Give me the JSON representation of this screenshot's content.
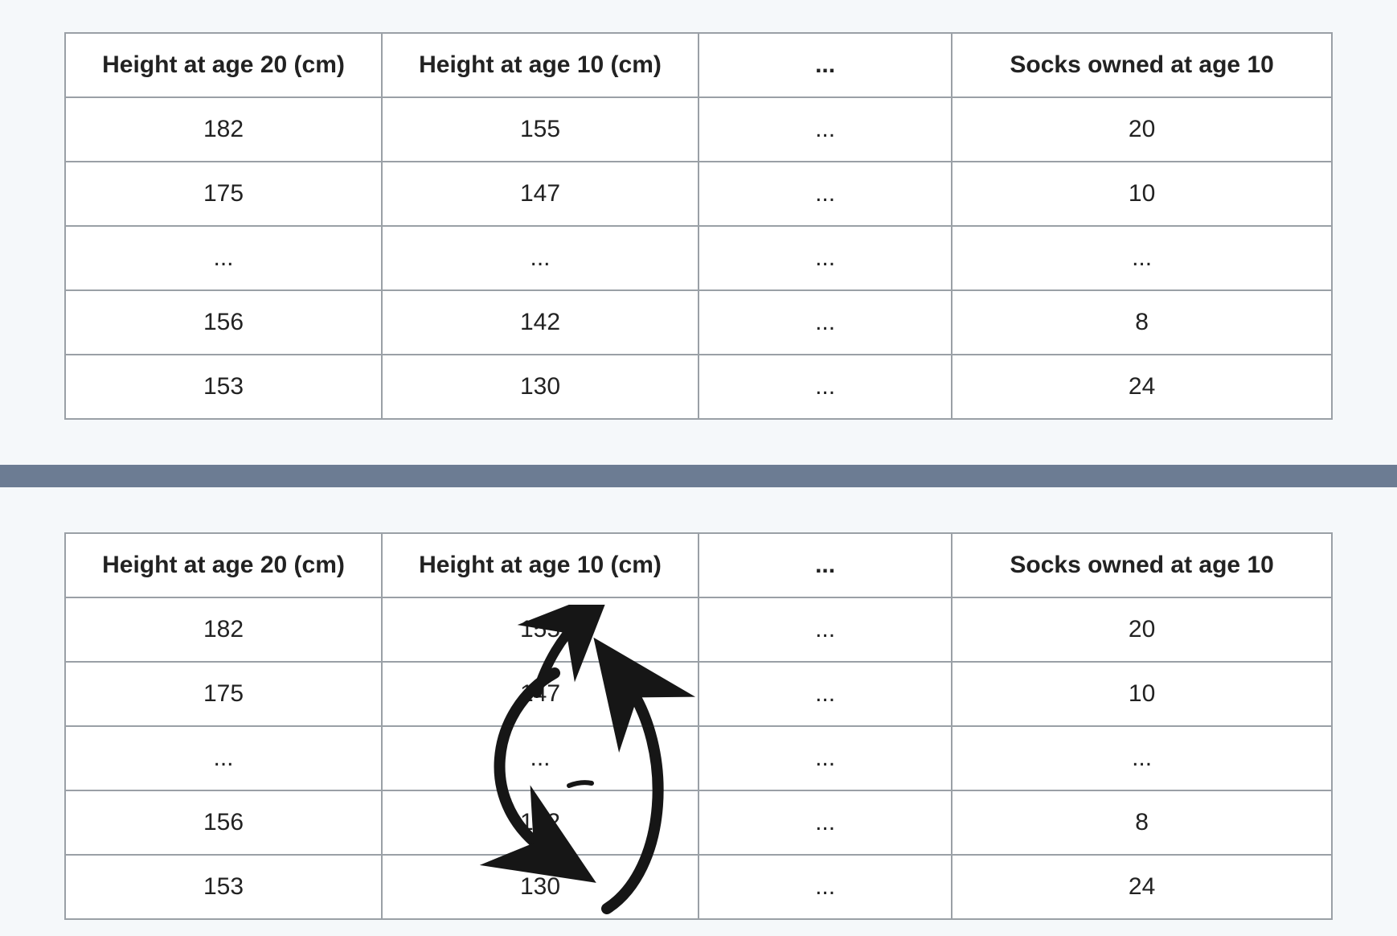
{
  "ellipsis": "...",
  "headers": {
    "col1": "Height at age 20 (cm)",
    "col2": "Height at age 10 (cm)",
    "col3": "...",
    "col4": "Socks owned at age 10"
  },
  "table1": {
    "rows": [
      {
        "c1": "182",
        "c2": "155",
        "c3": "...",
        "c4": "20"
      },
      {
        "c1": "175",
        "c2": "147",
        "c3": "...",
        "c4": "10"
      },
      {
        "c1": "...",
        "c2": "...",
        "c3": "...",
        "c4": "..."
      },
      {
        "c1": "156",
        "c2": "142",
        "c3": "...",
        "c4": "8"
      },
      {
        "c1": "153",
        "c2": "130",
        "c3": "...",
        "c4": "24"
      }
    ]
  },
  "table2": {
    "rows": [
      {
        "c1": "182",
        "c2": "155",
        "c3": "...",
        "c4": "20"
      },
      {
        "c1": "175",
        "c2": "147",
        "c3": "...",
        "c4": "10"
      },
      {
        "c1": "...",
        "c2": "...",
        "c3": "...",
        "c4": "..."
      },
      {
        "c1": "156",
        "c2": "142",
        "c3": "...",
        "c4": "8"
      },
      {
        "c1": "153",
        "c2": "130",
        "c3": "...",
        "c4": "24"
      }
    ],
    "annotation": "permutation-arrows"
  }
}
